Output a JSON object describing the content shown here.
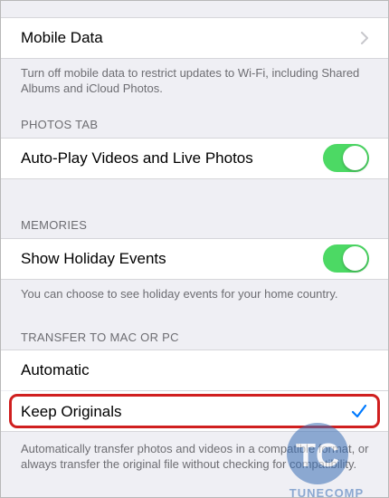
{
  "mobile_data": {
    "label": "Mobile Data",
    "footer": "Turn off mobile data to restrict updates to Wi-Fi, including Shared Albums and iCloud Photos."
  },
  "photos_tab": {
    "header": "PHOTOS TAB",
    "autoplay_label": "Auto-Play Videos and Live Photos",
    "autoplay_on": true
  },
  "memories": {
    "header": "MEMORIES",
    "holiday_label": "Show Holiday Events",
    "holiday_on": true,
    "footer": "You can choose to see holiday events for your home country."
  },
  "transfer": {
    "header": "TRANSFER TO MAC OR PC",
    "options": [
      {
        "label": "Automatic",
        "selected": false
      },
      {
        "label": "Keep Originals",
        "selected": true
      }
    ],
    "footer": "Automatically transfer photos and videos in a compatible format, or always transfer the original file without checking for compatibility."
  },
  "colors": {
    "toggle_on": "#4cd964",
    "checkmark": "#007aff",
    "highlight": "#d01f1f"
  },
  "watermark": {
    "text": "TUNECOMP",
    "logo_text": "TC"
  }
}
